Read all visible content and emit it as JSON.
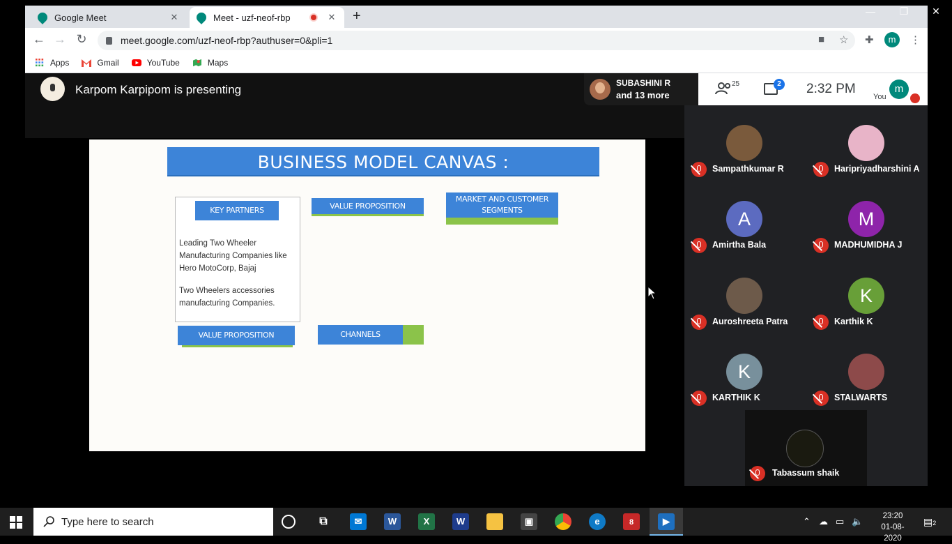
{
  "browser": {
    "tabs": [
      {
        "label": "Google Meet"
      },
      {
        "label": "Meet - uzf-neof-rbp"
      }
    ],
    "url": "meet.google.com/uzf-neof-rbp?authuser=0&pli=1",
    "profile_initial": "m",
    "bookmarks": [
      {
        "label": "Apps"
      },
      {
        "label": "Gmail"
      },
      {
        "label": "YouTube"
      },
      {
        "label": "Maps"
      }
    ]
  },
  "meet": {
    "presenting_text": "Karpom Karpipom is presenting",
    "others": {
      "name": "SUBASHINI R",
      "more": "and 13 more"
    },
    "people_count": "25",
    "chat_badge": "2",
    "clock": "2:32  PM",
    "you_label": "You",
    "you_initial": "m",
    "participants": [
      {
        "name": "Sampathkumar R",
        "initial": "",
        "color": "#7a5a3c"
      },
      {
        "name": "Haripriyadharshini A",
        "initial": "",
        "color": "#e8b4c8"
      },
      {
        "name": "Amirtha Bala",
        "initial": "A",
        "color": "#5c6bc0"
      },
      {
        "name": "MADHUMIDHA J",
        "initial": "M",
        "color": "#8e24aa"
      },
      {
        "name": "Auroshreeta Patra",
        "initial": "",
        "color": "#6d5a4a"
      },
      {
        "name": "Karthik K",
        "initial": "K",
        "color": "#689f38"
      },
      {
        "name": "KARTHIK K",
        "initial": "K",
        "color": "#78909c"
      },
      {
        "name": "STALWARTS",
        "initial": "",
        "color": "#8d4a4a"
      }
    ],
    "last_participant": {
      "name": "Tabassum shaik",
      "color": "#1a1a10"
    }
  },
  "slide": {
    "title": "BUSINESS MODEL CANVAS :",
    "key_partners": "KEY PARTNERS",
    "value_prop_top": "VALUE PROPOSITION",
    "market_line1": "MARKET AND CUSTOMER",
    "market_line2": "SEGMENTS",
    "kp_text1": "Leading Two Wheeler Manufacturing Companies like Hero MotoCorp, Bajaj",
    "kp_text2": "Two Wheelers accessories manufacturing Companies.",
    "value_prop_bottom": "VALUE PROPOSITION",
    "channels": "CHANNELS"
  },
  "taskbar": {
    "search_placeholder": "Type here to search",
    "time": "23:20",
    "date": "01-08-2020",
    "notification_count": "2",
    "whatsapp_badge": "8"
  },
  "colors": {
    "slide_blue": "#3d84d8",
    "slide_green": "#8bc34a",
    "mute_red": "#d93025",
    "meet_teal": "#00897b"
  }
}
